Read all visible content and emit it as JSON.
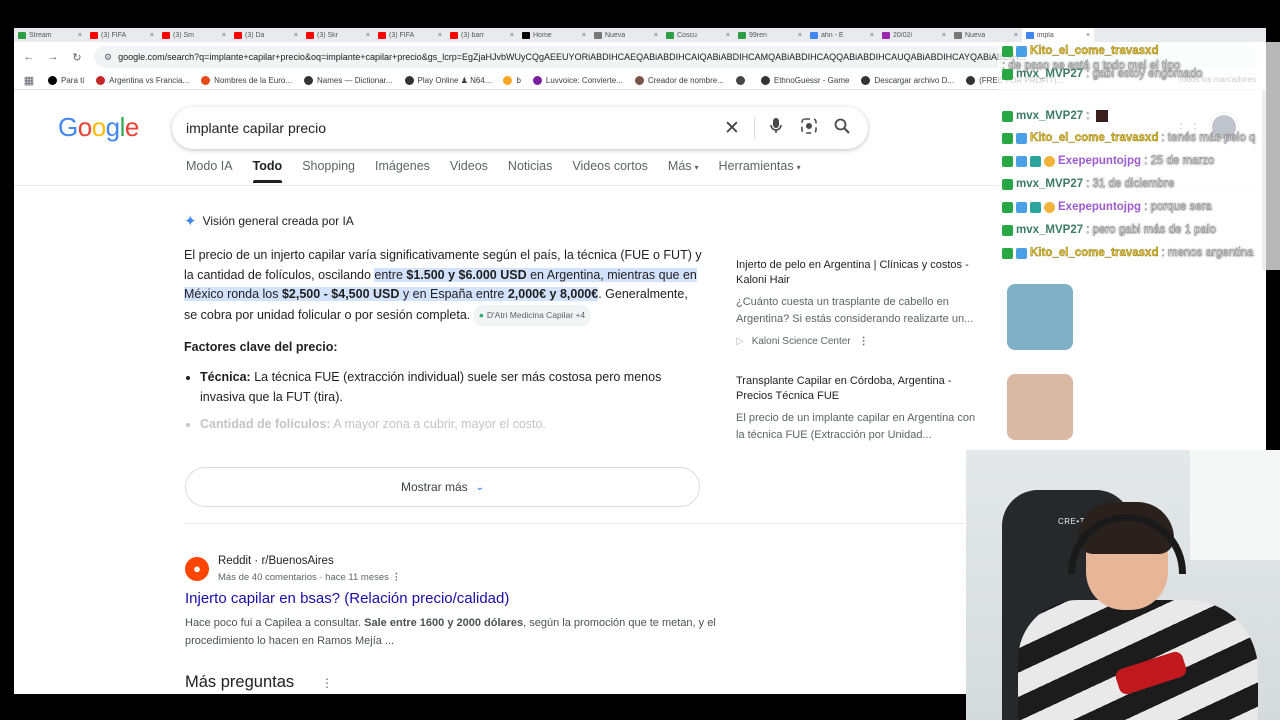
{
  "tabs": [
    {
      "title": "Stream",
      "color": "#2ea043"
    },
    {
      "title": "(3) FIFA",
      "color": "#ff0000"
    },
    {
      "title": "(3) Sm",
      "color": "#ff0000"
    },
    {
      "title": "(3) Da",
      "color": "#ff0000"
    },
    {
      "title": "(3) Skr",
      "color": "#ff0000"
    },
    {
      "title": "(3) FIFA",
      "color": "#ff0000"
    },
    {
      "title": "(3) barr",
      "color": "#ff0000"
    },
    {
      "title": "Home",
      "color": "#000000"
    },
    {
      "title": "Nueva",
      "color": "#777777"
    },
    {
      "title": "Coscu",
      "color": "#2ea043"
    },
    {
      "title": "99ren",
      "color": "#2ea043"
    },
    {
      "title": "ahn - E",
      "color": "#4285f4"
    },
    {
      "title": "20/02/",
      "color": "#9c27b0"
    },
    {
      "title": "Nueva",
      "color": "#777777"
    },
    {
      "title": "impla",
      "color": "#4285f4"
    }
  ],
  "omnibox": {
    "url": "google.com/search?q=implante+capilar+precio&oq=implante+capilar+precio&gs_lcrp=EgZjaHJvbWUyCQgAEEUYORiABDIHCAEQABiABDIHCAIQABiABDIHCAMQABiABDIHCAQQABiABDIHCAUQABiABDIHCAYQABiABDIH..."
  },
  "bookmarks": [
    "Para ti",
    "Argentina vs Francia...",
    "Nombres de la Euro...",
    "Names — Dictionar...",
    "Play Online ♟ N64...",
    "b",
    "Luvvoice: Convierte...",
    "Creador de nombre...",
    "",
    "EthnoGuessr - Game",
    "Descargar archivo D...",
    "(FREE FOR PROFIT)..."
  ],
  "bookmarks_all": "Todos los marcadores",
  "google": {
    "logo": "Google",
    "query": "implante capilar precio",
    "tabs": [
      {
        "label": "Modo IA",
        "active": false,
        "caret": ""
      },
      {
        "label": "Todo",
        "active": true,
        "caret": ""
      },
      {
        "label": "Shopping",
        "active": false,
        "caret": ""
      },
      {
        "label": "Imágenes",
        "active": false,
        "caret": ""
      },
      {
        "label": "Videos",
        "active": false,
        "caret": ""
      },
      {
        "label": "Noticias",
        "active": false,
        "caret": ""
      },
      {
        "label": "Videos cortos",
        "active": false,
        "caret": ""
      },
      {
        "label": "Más",
        "active": false,
        "caret": "▾"
      },
      {
        "label": "Herramientas",
        "active": false,
        "caret": "▾"
      }
    ]
  },
  "ai_overview": {
    "header": "Visión general creada por IA",
    "p1": "El precio de un injerto capilar varía significativamente según el país, la técnica (FUE o FUT) y la cantidad de folículos, oscilando ",
    "hl1": "entre ",
    "hl2": "$1.500 y $6.000 USD",
    "hl3": " en Argentina, mientras que en México ronda los ",
    "hl4": "$2,500 - $4,500 USD",
    "hl5": " y en España entre ",
    "hl6": "2,000€ y 8,000€",
    "p2": ". Generalmente, se cobra por unidad folicular o por sesión completa.",
    "source_chip": "D'Atri Medicina Capilar +4",
    "factors_title": "Factores clave del precio:",
    "item1_bold": "Técnica:",
    "item1_text": " La técnica FUE (extracción individual) suele ser más costosa pero menos invasiva que la FUT (tira).",
    "item2_bold": "Cantidad de folículos:",
    "item2_text": " A mayor zona a cubrir, mayor el costo.",
    "more_label": "Mostrar más"
  },
  "sources": [
    {
      "title": "Injerto de pelo en Argentina | Clínicas y costos - Kaloni Hair",
      "snippet": "¿Cuánto cuesta un trasplante de cabello en Argentina? Si estás considerando realizarte un...",
      "site": "Kaloni Science Center",
      "thumb_color": "#7fb0c8"
    },
    {
      "title": "Transplante Capilar en Córdoba, Argentina - Precios Técnica FUE",
      "snippet": "El precio de un implante capilar en Argentina con la técnica FUE (Extracción por Unidad...",
      "site": "",
      "thumb_color": "#d9b9a3"
    }
  ],
  "reddit": {
    "site": "Reddit · r/BuenosAires",
    "meta": "Más de 40 comentarios · hace 11 meses",
    "title": "Injerto capilar en bsas? (Relación precio/calidad)",
    "snippet_a": "Hace poco fui a Capilea a consultar. ",
    "snippet_b": "Sale entre 1600 y 2000 dólares",
    "snippet_c": ", según la promoción que te metan, y el procedimiento lo hacen en Ramos Mejía ..."
  },
  "mas_preguntas": "Más preguntas",
  "chat": [
    {
      "user": "Kito_el_come_travasxd",
      "msg": ": de paso se está q todo mal el tipo",
      "ucolor": "kito"
    },
    {
      "user": "mvx_MVP27",
      "msg": ": gabi estoy engomado",
      "ucolor": "mvx"
    },
    {
      "user": "mvx_MVP27",
      "msg": ":",
      "ucolor": "mvx"
    },
    {
      "user": "Kito_el_come_travasxd",
      "msg": ": tenés más pelo q",
      "ucolor": "kito"
    },
    {
      "user": "Exepepuntojpg",
      "msg": ": 25 de marzo",
      "ucolor": "exe"
    },
    {
      "user": "mvx_MVP27",
      "msg": ": 31 de diciembre",
      "ucolor": "mvx"
    },
    {
      "user": "Exepepuntojpg",
      "msg": ": porque sera",
      "ucolor": "exe"
    },
    {
      "user": "mvx_MVP27",
      "msg": ": pero gabi más de 1 palo",
      "ucolor": "mvx"
    },
    {
      "user": "Kito_el_come_travasxd",
      "msg": ": menos argentina",
      "ucolor": "kito"
    }
  ],
  "webcam": {
    "chair_text": "CRE•TION"
  },
  "colors": {
    "link": "#1a0dab",
    "highlight": "#d3e3fd",
    "reddit": "#ff4500"
  }
}
